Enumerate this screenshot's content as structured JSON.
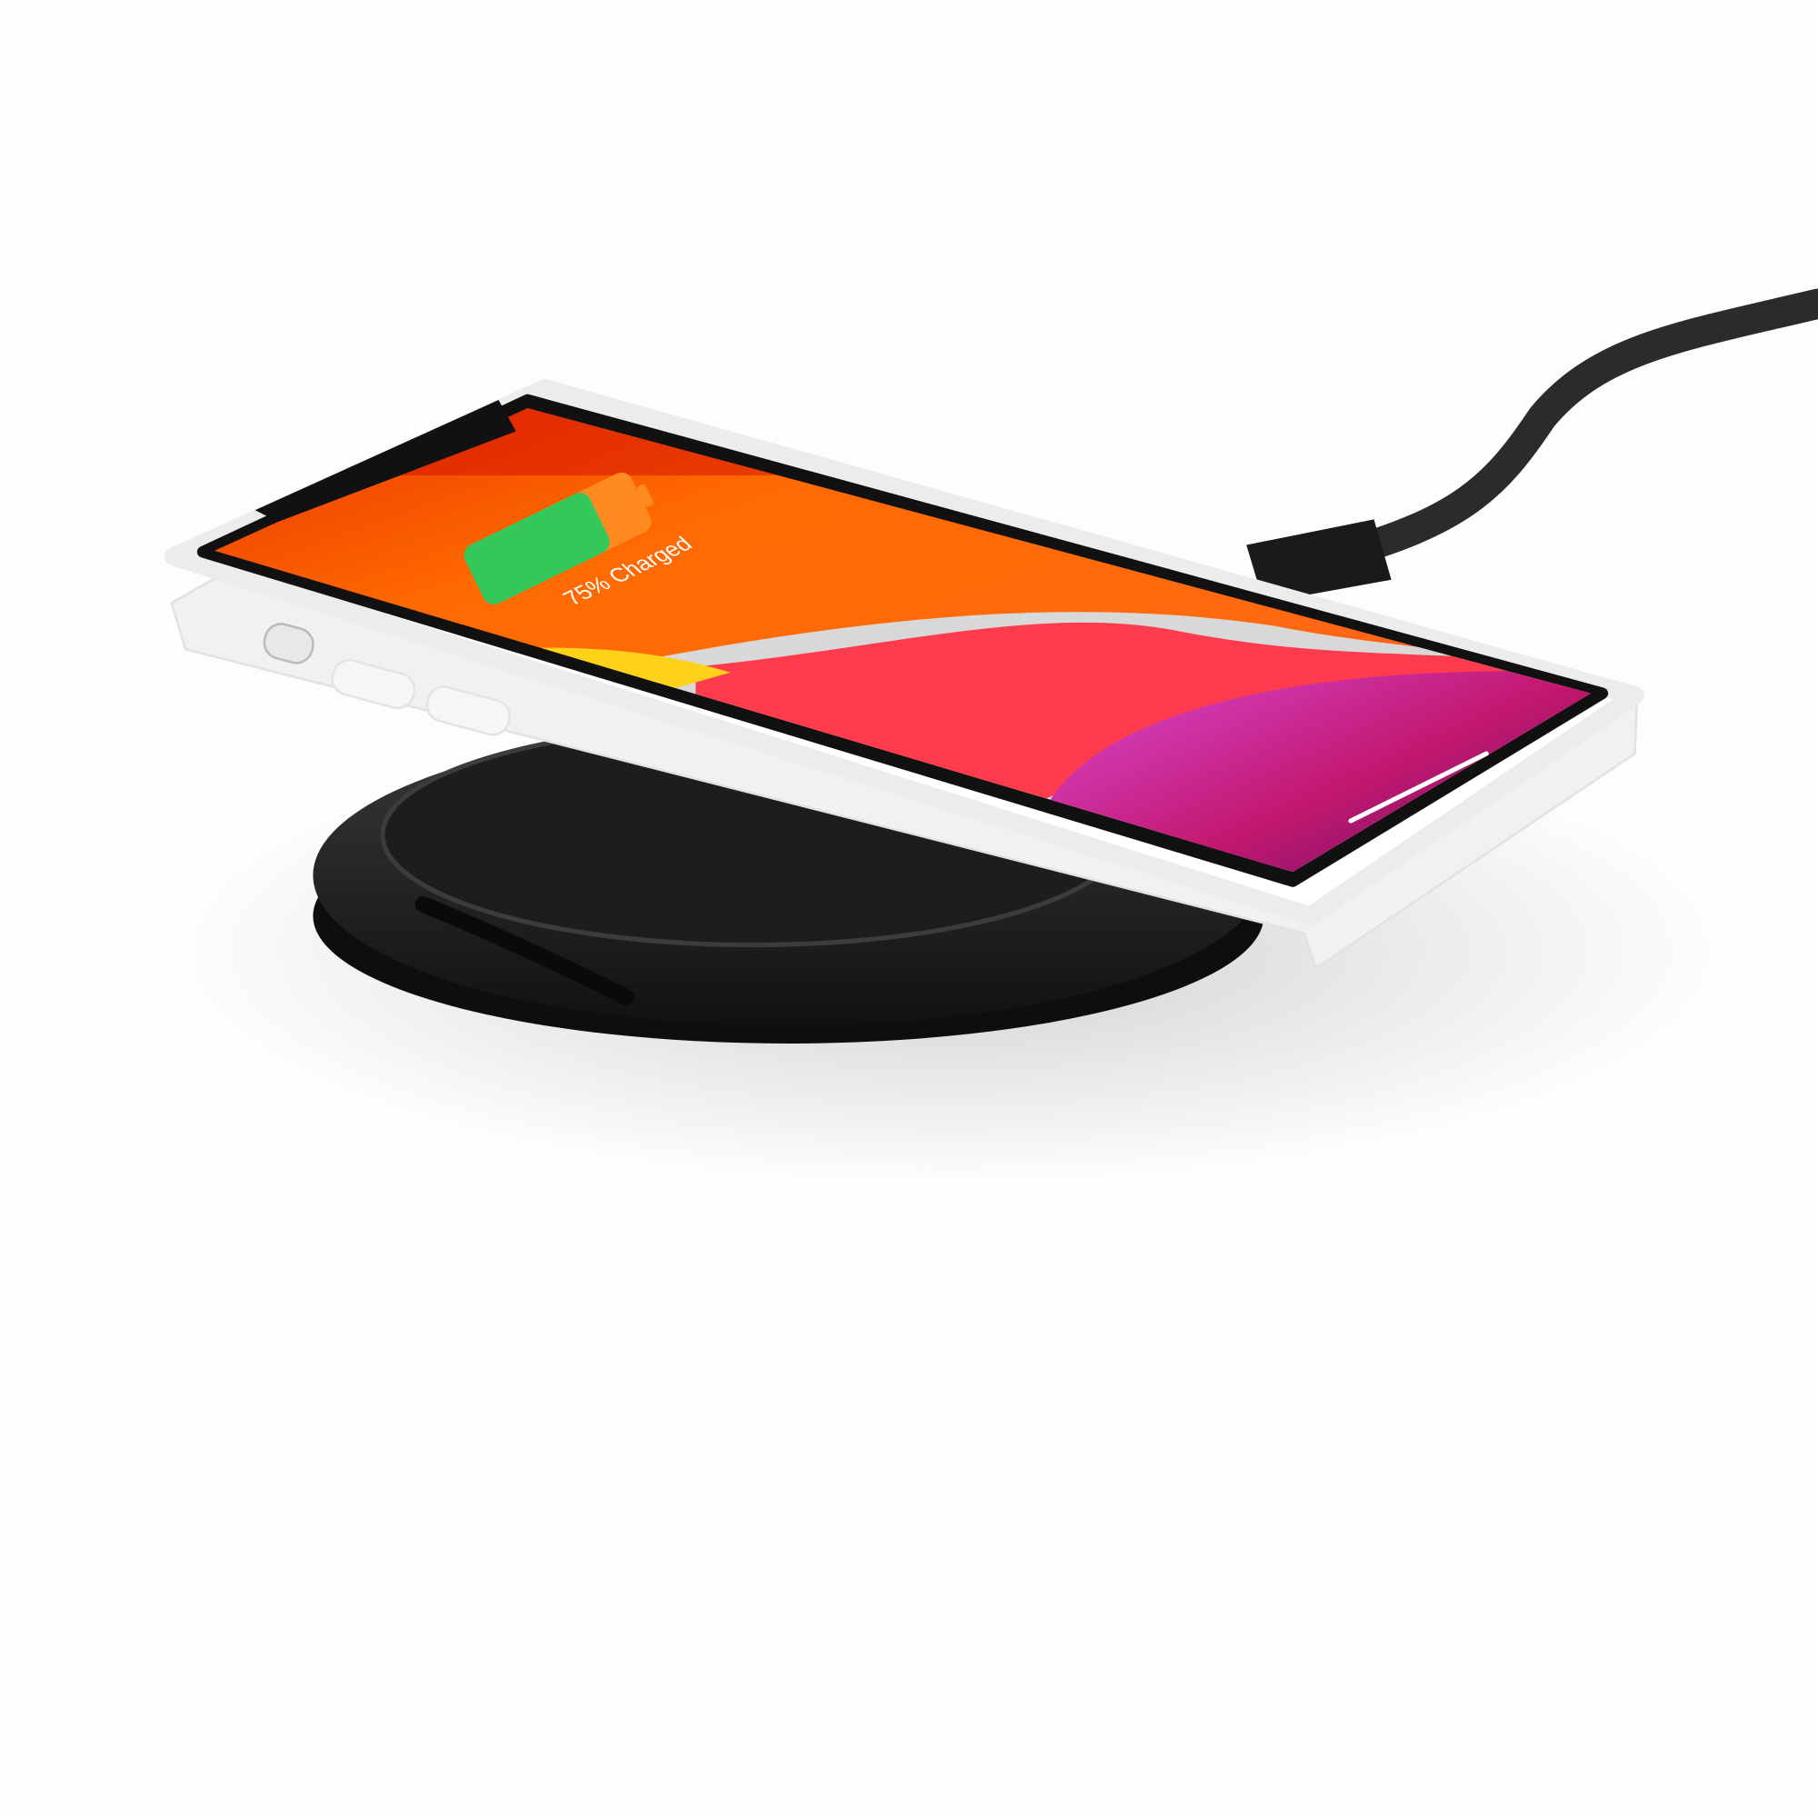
{
  "screen": {
    "battery_text": "75% Charged",
    "battery_level_percent": 75
  },
  "colors": {
    "background": "#fdfdfd",
    "wallpaper_orange": "#ff6a00",
    "wallpaper_red": "#ff3b4d",
    "wallpaper_magenta": "#c2176e",
    "battery_green": "#34c759",
    "case_white": "#ffffff",
    "charger_black": "#222222"
  }
}
